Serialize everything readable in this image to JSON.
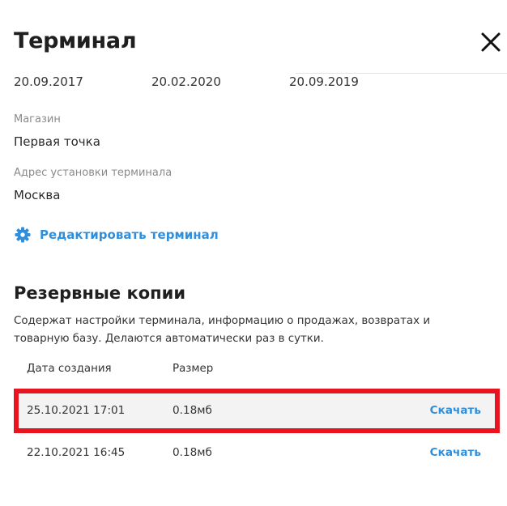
{
  "header": {
    "title": "Терминал",
    "close_icon": "close-icon"
  },
  "dates": [
    "20.09.2017",
    "20.02.2020",
    "20.09.2019"
  ],
  "fields": {
    "store": {
      "label": "Магазин",
      "value": "Первая точка"
    },
    "address": {
      "label": "Адрес установки терминала",
      "value": "Москва"
    }
  },
  "edit": {
    "icon": "gear-icon",
    "label": "Редактировать терминал"
  },
  "backups": {
    "title": "Резервные копии",
    "description": "Содержат настройки терминала, информацию о продажах, возвратах и товарную базу. Делаются автоматически раз в сутки.",
    "columns": {
      "date": "Дата создания",
      "size": "Размер"
    },
    "rows": [
      {
        "date": "25.10.2021 17:01",
        "size": "0.18мб",
        "action": "Скачать",
        "highlighted": true
      },
      {
        "date": "22.10.2021 16:45",
        "size": "0.18мб",
        "action": "Скачать",
        "highlighted": false
      }
    ]
  },
  "colors": {
    "accent": "#2f8fdc",
    "highlight_border": "#e8141f",
    "highlight_background": "#f3f3f3"
  }
}
